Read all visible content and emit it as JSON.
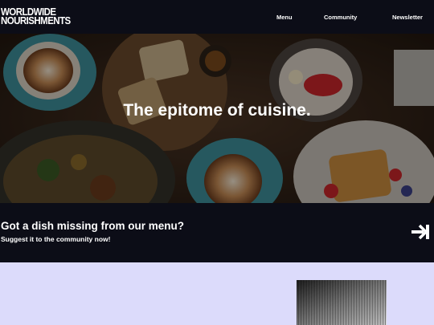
{
  "brand": {
    "line1": "WORLDWIDE",
    "line2": "NOURISHMENTS"
  },
  "nav": {
    "menu": "Menu",
    "community": "Community",
    "newsletter": "Newsletter"
  },
  "hero": {
    "title": "The epitome of cuisine."
  },
  "cta": {
    "title": "Got a dish missing from our menu?",
    "subtitle": "Suggest it to the community now!",
    "icon": "arrow-right-to-bar-icon"
  },
  "colors": {
    "header_bg": "#0c0d17",
    "lower_bg": "#dcdbfb",
    "text": "#ffffff"
  }
}
